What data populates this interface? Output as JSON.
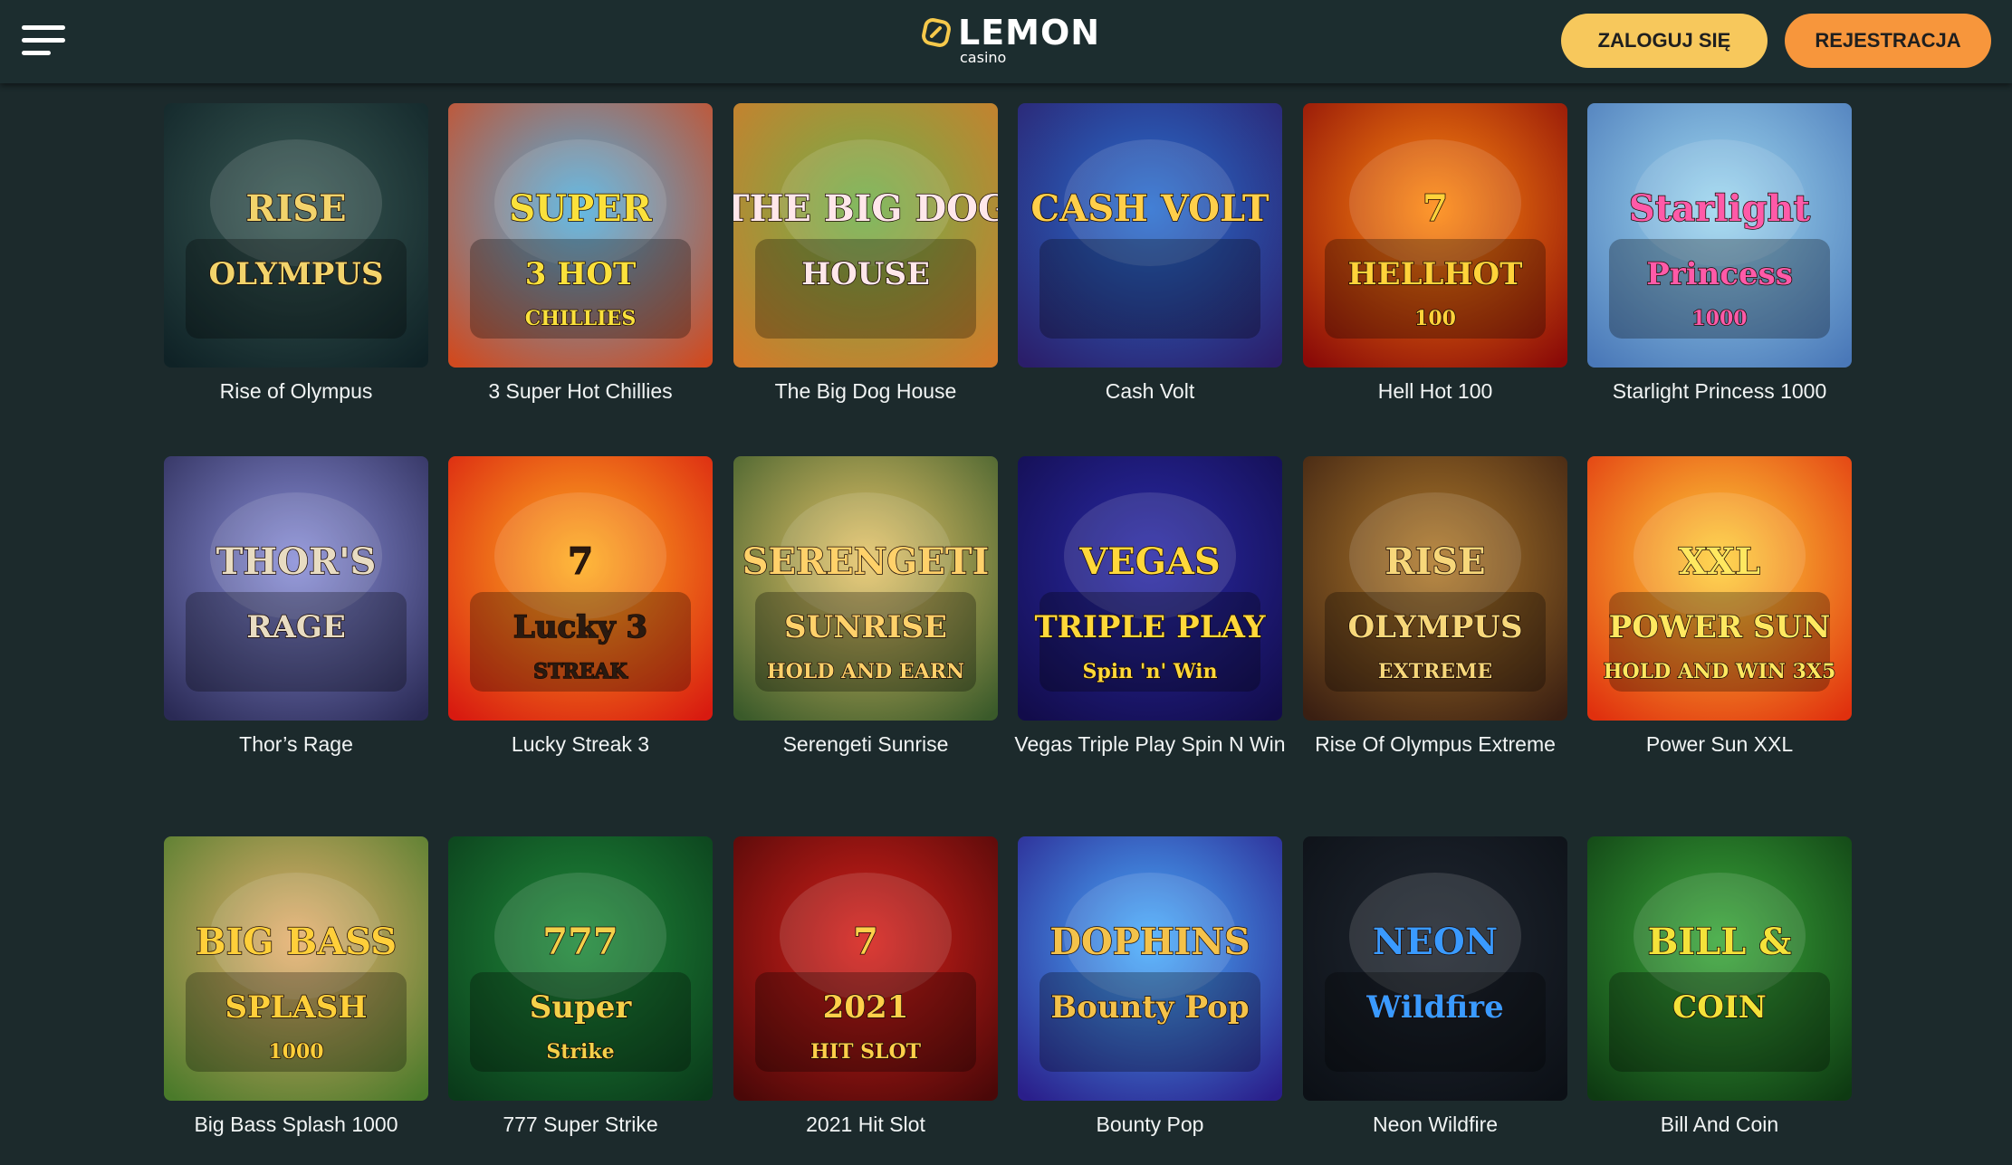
{
  "header": {
    "logo_word": "LEMON",
    "logo_sub": "casino",
    "login_label": "ZALOGUJ SIĘ",
    "register_label": "REJESTRACJA",
    "brand_yellow": "#f7c85c",
    "brand_orange": "#f7963c"
  },
  "games": [
    {
      "title": "Rise of Olympus",
      "logo_line1": "RISE",
      "logo_line2": "OLYMPUS",
      "logo_line3": "",
      "bg1": "#3a5a55",
      "bg2": "#0f2226",
      "text_color": "#f2d36b"
    },
    {
      "title": "3 Super Hot Chillies",
      "logo_line1": "SUPER",
      "logo_line2": "3 HOT",
      "logo_line3": "CHILLIES",
      "bg1": "#4fb0e0",
      "bg2": "#d04a20",
      "text_color": "#fbe13c"
    },
    {
      "title": "The Big Dog House",
      "logo_line1": "THE BIG DOG",
      "logo_line2": "HOUSE",
      "logo_line3": "",
      "bg1": "#6fb04a",
      "bg2": "#d27a2a",
      "text_color": "#ffe7ea"
    },
    {
      "title": "Cash Volt",
      "logo_line1": "CASH VOLT",
      "logo_line2": "",
      "logo_line3": "",
      "bg1": "#2a6fd0",
      "bg2": "#2b1e6a",
      "text_color": "#ffcf4a"
    },
    {
      "title": "Hell Hot 100",
      "logo_line1": "7",
      "logo_line2": "HELLHOT",
      "logo_line3": "100",
      "bg1": "#ff8a10",
      "bg2": "#8a0a08",
      "text_color": "#ffd23a"
    },
    {
      "title": "Starlight Princess 1000",
      "logo_line1": "Starlight",
      "logo_line2": "Princess",
      "logo_line3": "1000",
      "bg1": "#9fd8f0",
      "bg2": "#4a78b8",
      "text_color": "#ff5aa8"
    },
    {
      "title": "Thor’s Rage",
      "logo_line1": "THOR'S",
      "logo_line2": "RAGE",
      "logo_line3": "",
      "bg1": "#8a8fd8",
      "bg2": "#2a2a55",
      "text_color": "#e8dcc2"
    },
    {
      "title": "Lucky Streak 3",
      "logo_line1": "7",
      "logo_line2": "Lucky 3",
      "logo_line3": "STREAK",
      "bg1": "#ffb020",
      "bg2": "#d81a10",
      "text_color": "#2a1a10"
    },
    {
      "title": "Serengeti Sunrise",
      "logo_line1": "SERENGETI",
      "logo_line2": "SUNRISE",
      "logo_line3": "HOLD AND EARN",
      "bg1": "#e8c66a",
      "bg2": "#3a5a2a",
      "text_color": "#ffd16a"
    },
    {
      "title": "Vegas Triple Play Spin N Win",
      "logo_line1": "VEGAS",
      "logo_line2": "TRIPLE PLAY",
      "logo_line3": "Spin 'n' Win",
      "bg1": "#2a2aa8",
      "bg2": "#120c4a",
      "text_color": "#ffd83a"
    },
    {
      "title": "Rise Of Olympus Extreme",
      "logo_line1": "RISE",
      "logo_line2": "OLYMPUS",
      "logo_line3": "EXTREME",
      "bg1": "#b07a2a",
      "bg2": "#3a1f12",
      "text_color": "#f7d77a"
    },
    {
      "title": "Power Sun XXL",
      "logo_line1": "XXL",
      "logo_line2": "POWER SUN",
      "logo_line3": "HOLD AND WIN 3X5",
      "bg1": "#ffd23a",
      "bg2": "#e0300e",
      "text_color": "#ffe860"
    },
    {
      "title": "Big Bass Splash 1000",
      "logo_line1": "BIG BASS",
      "logo_line2": "SPLASH",
      "logo_line3": "1000",
      "bg1": "#e8b070",
      "bg2": "#4a7a2a",
      "text_color": "#ffcf3a"
    },
    {
      "title": "777 Super Strike",
      "logo_line1": "777",
      "logo_line2": "Super",
      "logo_line3": "Strike",
      "bg1": "#1f8a3a",
      "bg2": "#0a3a1a",
      "text_color": "#f4d04a"
    },
    {
      "title": "2021 Hit Slot",
      "logo_line1": "7",
      "logo_line2": "2021",
      "logo_line3": "HIT SLOT",
      "bg1": "#d8201a",
      "bg2": "#4a0808",
      "text_color": "#ffcf4a"
    },
    {
      "title": "Bounty Pop",
      "logo_line1": "DOPHINS",
      "logo_line2": "Bounty Pop",
      "logo_line3": "",
      "bg1": "#4ab0ff",
      "bg2": "#2a1e8a",
      "text_color": "#f4c24a"
    },
    {
      "title": "Neon Wildfire",
      "logo_line1": "NEON",
      "logo_line2": "Wildfire",
      "logo_line3": "",
      "bg1": "#1f2630",
      "bg2": "#0c1016",
      "text_color": "#3a9aff"
    },
    {
      "title": "Bill And Coin",
      "logo_line1": "BILL &",
      "logo_line2": "COIN",
      "logo_line3": "",
      "bg1": "#3aa83a",
      "bg2": "#0e3a12",
      "text_color": "#f4e23a"
    }
  ]
}
